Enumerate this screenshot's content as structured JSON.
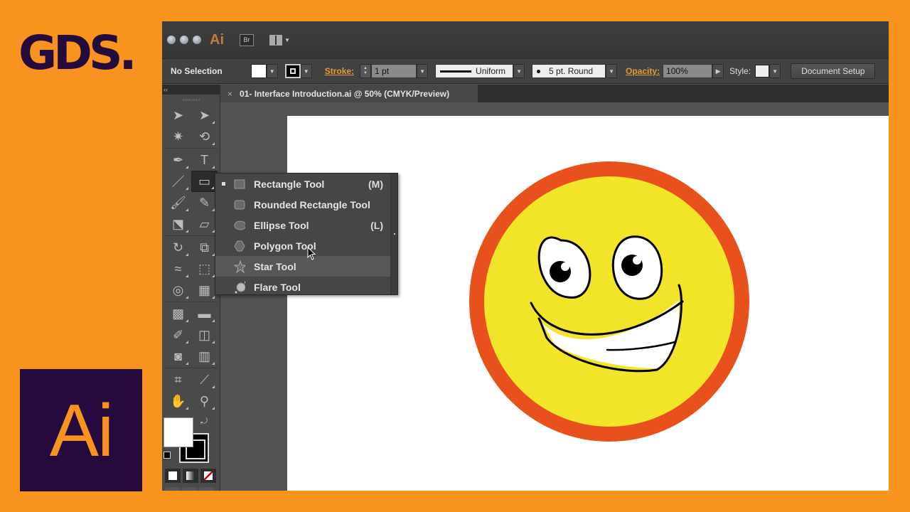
{
  "branding": {
    "channel_logo": "GDS.",
    "product_badge": "Ai",
    "brand_colors": {
      "background": "#f7931e",
      "logo": "#230b3b",
      "badge_bg": "#250a3e"
    }
  },
  "titlebar": {
    "app_icon": "Ai",
    "bridge_button": "Br",
    "workspace_icon": "workspace-layout-icon"
  },
  "control_bar": {
    "selection_label": "No Selection",
    "fill_color": "#ffffff",
    "stroke_label": "Stroke:",
    "stroke_weight": "1 pt",
    "stroke_profile": "Uniform",
    "brush": "5 pt. Round",
    "opacity_label": "Opacity:",
    "opacity_value": "100%",
    "style_label": "Style:",
    "document_setup": "Document Setup"
  },
  "document_tab": {
    "close": "×",
    "title": "01- Interface Introduction.ai @ 50% (CMYK/Preview)"
  },
  "toolbox": {
    "collapse": "‹‹",
    "tools": [
      {
        "name": "selection-tool",
        "glyph": "➤"
      },
      {
        "name": "direct-selection-tool",
        "glyph": "➤"
      },
      {
        "name": "magic-wand-tool",
        "glyph": "✷"
      },
      {
        "name": "lasso-tool",
        "glyph": "⟲"
      },
      {
        "name": "pen-tool",
        "glyph": "✒"
      },
      {
        "name": "type-tool",
        "glyph": "T"
      },
      {
        "name": "line-segment-tool",
        "glyph": "／"
      },
      {
        "name": "rectangle-tool",
        "glyph": "▭"
      },
      {
        "name": "paintbrush-tool",
        "glyph": "🖌"
      },
      {
        "name": "pencil-tool",
        "glyph": "✎"
      },
      {
        "name": "blob-brush-tool",
        "glyph": "⬔"
      },
      {
        "name": "eraser-tool",
        "glyph": "▱"
      },
      {
        "name": "rotate-tool",
        "glyph": "↻"
      },
      {
        "name": "scale-tool",
        "glyph": "⧉"
      },
      {
        "name": "width-tool",
        "glyph": "≈"
      },
      {
        "name": "free-transform-tool",
        "glyph": "⬚"
      },
      {
        "name": "shape-builder-tool",
        "glyph": "◎"
      },
      {
        "name": "perspective-grid-tool",
        "glyph": "▦"
      },
      {
        "name": "mesh-tool",
        "glyph": "▩"
      },
      {
        "name": "gradient-tool",
        "glyph": "▬"
      },
      {
        "name": "eyedropper-tool",
        "glyph": "✐"
      },
      {
        "name": "blend-tool",
        "glyph": "◫"
      },
      {
        "name": "symbol-sprayer-tool",
        "glyph": "◙"
      },
      {
        "name": "column-graph-tool",
        "glyph": "▥"
      },
      {
        "name": "artboard-tool",
        "glyph": "⌗"
      },
      {
        "name": "slice-tool",
        "glyph": "⟋"
      },
      {
        "name": "hand-tool",
        "glyph": "✋"
      },
      {
        "name": "zoom-tool",
        "glyph": "⚲"
      }
    ],
    "fill": "#ffffff",
    "stroke": "#000000",
    "swap_glyph": "⤾"
  },
  "shape_flyout": {
    "items": [
      {
        "label": "Rectangle Tool",
        "shortcut": "(M)",
        "icon": "rectangle-icon",
        "selected": true
      },
      {
        "label": "Rounded Rectangle Tool",
        "shortcut": "",
        "icon": "rounded-rectangle-icon"
      },
      {
        "label": "Ellipse Tool",
        "shortcut": "(L)",
        "icon": "ellipse-icon"
      },
      {
        "label": "Polygon Tool",
        "shortcut": "",
        "icon": "polygon-icon"
      },
      {
        "label": "Star Tool",
        "shortcut": "",
        "icon": "star-icon",
        "hover": true
      },
      {
        "label": "Flare Tool",
        "shortcut": "",
        "icon": "flare-icon"
      }
    ]
  },
  "artwork": {
    "subject": "smiley face",
    "ring_color": "#e8501e",
    "face_color": "#f2e429"
  }
}
